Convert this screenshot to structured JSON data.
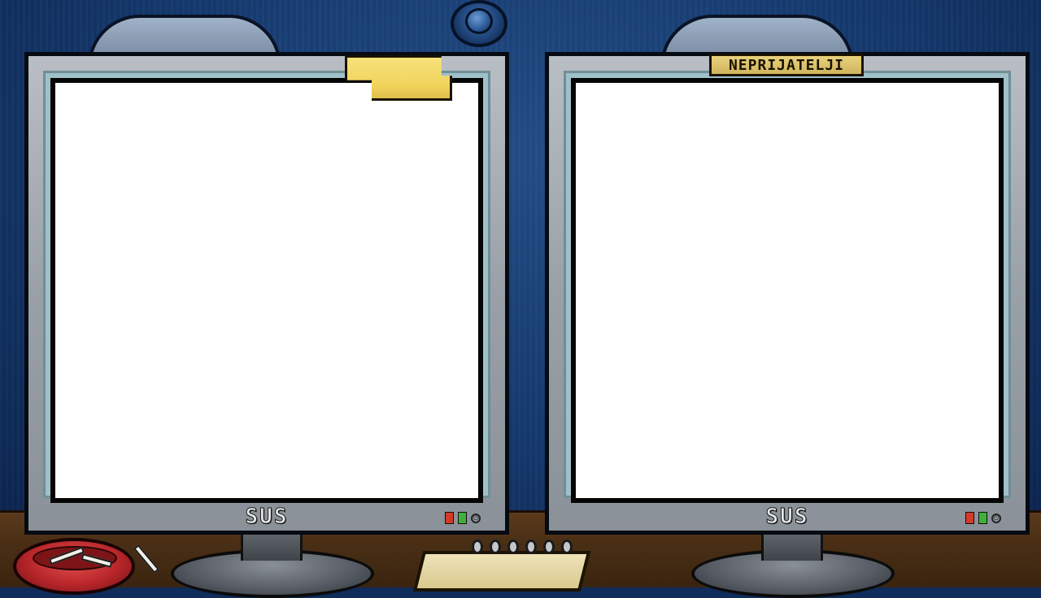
{
  "scene": {
    "wall_color": "#173d73",
    "desk_color": "#4a2f15"
  },
  "left_monitor": {
    "brand": "SUS",
    "screen_state": "blank",
    "indicator_colors": [
      "#d43b27",
      "#3fb13a"
    ]
  },
  "right_monitor": {
    "brand": "SUS",
    "label_tag": "NEPRIJATELJI",
    "screen_state": "blank",
    "indicator_colors": [
      "#d43b27",
      "#3fb13a"
    ]
  },
  "props": {
    "sticky_note_color": "#f1d35c",
    "ashtray_color": "#b8262a",
    "notepad_color": "#efe3b8"
  }
}
